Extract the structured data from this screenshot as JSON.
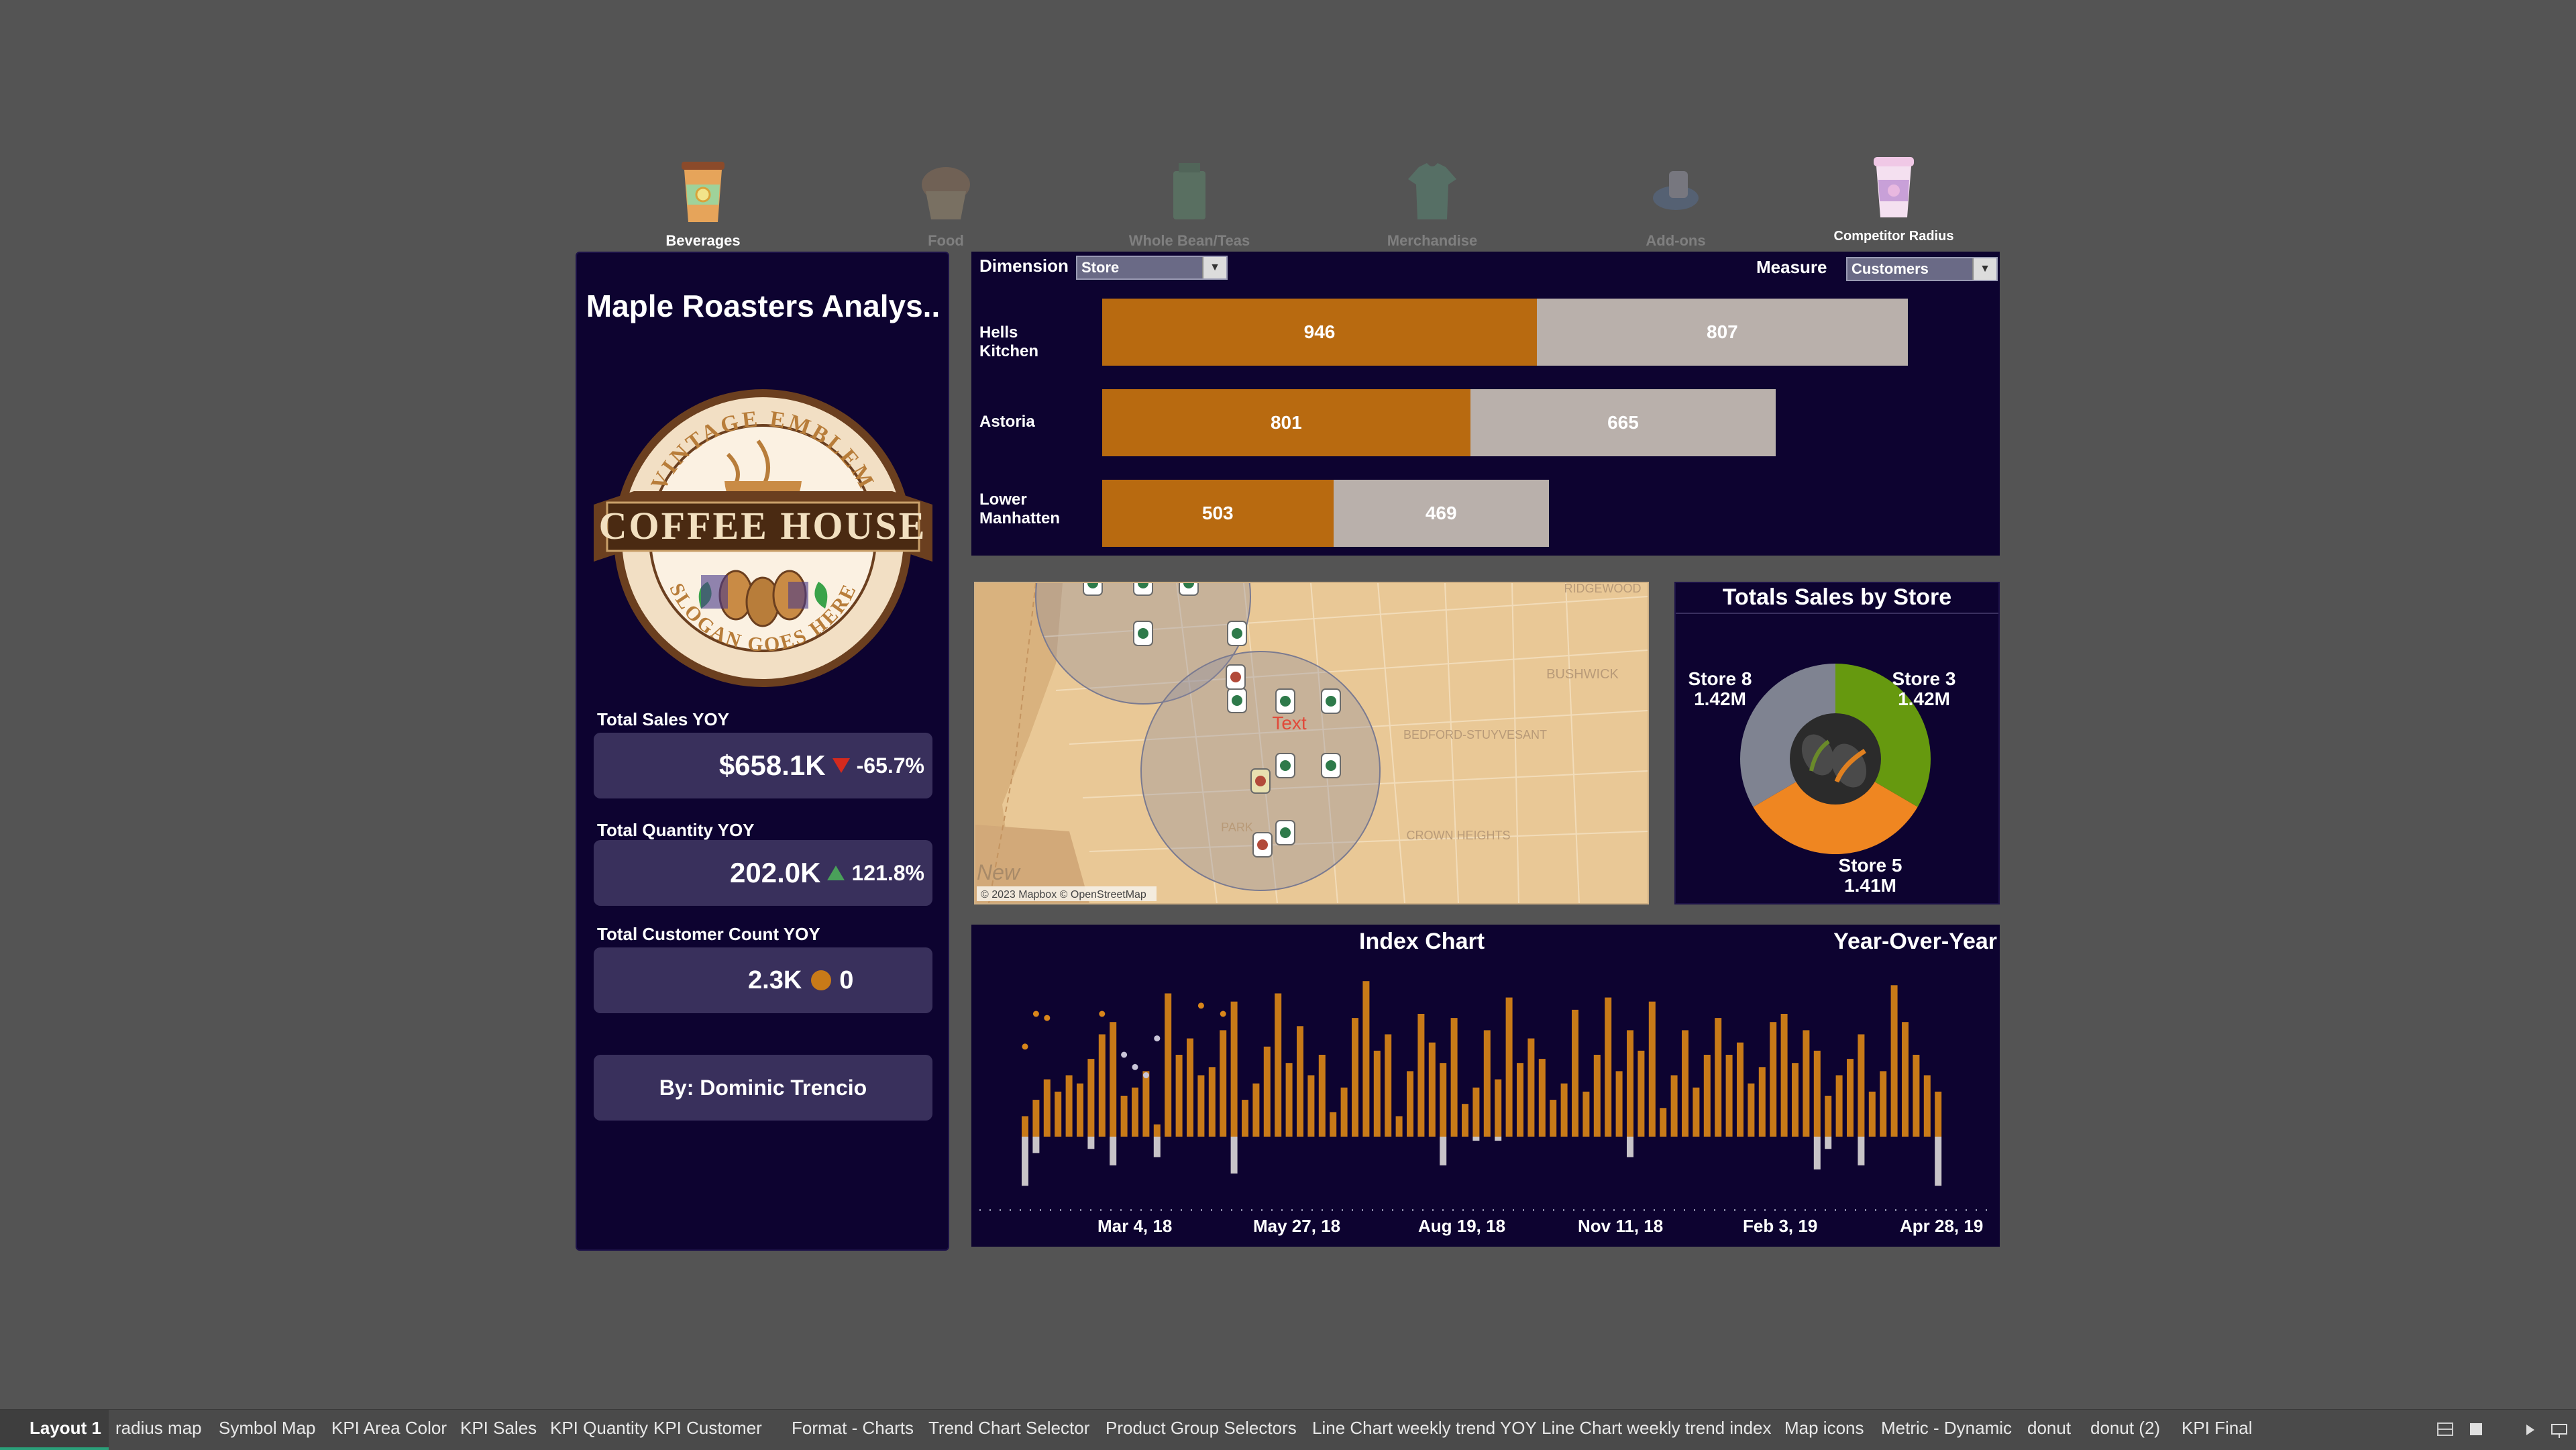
{
  "nav": [
    {
      "label": "Beverages",
      "icon": "beverage-cup-icon",
      "active": true
    },
    {
      "label": "Food",
      "icon": "muffin-icon",
      "active": false
    },
    {
      "label": "Whole Bean/Teas",
      "icon": "coffee-bag-icon",
      "active": false
    },
    {
      "label": "Merchandise",
      "icon": "tshirt-icon",
      "active": false
    },
    {
      "label": "Add-ons",
      "icon": "sauce-cup-icon",
      "active": false
    },
    {
      "label": "Competitor Radius",
      "icon": "competitor-cup-icon",
      "active": true
    }
  ],
  "left": {
    "title": "Maple Roasters Analys..",
    "logo": {
      "top": "VINTAGE EMBLEM",
      "middle": "COFFEE HOUSE",
      "bottom": "SLOGAN GOES HERE"
    },
    "kpis": [
      {
        "label": "Total Sales YOY",
        "value": "$658.1K",
        "change": "-65.7%",
        "indicator": "down"
      },
      {
        "label": "Total Quantity YOY",
        "value": "202.0K",
        "change": "121.8%",
        "indicator": "up"
      },
      {
        "label": "Total Customer Count YOY",
        "value": "2.3K",
        "change": "0",
        "indicator": "neutral"
      }
    ],
    "author": "By: Dominic Trencio"
  },
  "bars": {
    "dimension_label": "Dimension",
    "dimension_value": "Store",
    "measure_label": "Measure",
    "measure_value": "Customers",
    "rows": [
      {
        "category": "Hells Kitchen",
        "current": 946,
        "previous": 807
      },
      {
        "category": "Astoria",
        "current": 801,
        "previous": 665
      },
      {
        "category": "Lower Manhatten",
        "current": 503,
        "previous": 469
      }
    ],
    "colors": {
      "current": "#b86a10",
      "previous": "#b9b0ab"
    }
  },
  "map": {
    "attribution": "© 2023 Mapbox © OpenStreetMap",
    "areas": [
      "RIDGEWOOD",
      "BUSHWICK",
      "BEDFORD-STUYVESANT",
      "CROWN HEIGHTS",
      "PARK"
    ],
    "corner_text": "New",
    "marker_text": "Text",
    "store_marker_icon": "store-cup-icon",
    "competitor_marker_icon": "competitor-cup-icon"
  },
  "pie": {
    "title": "Totals Sales by Store",
    "center_icon": "coffee-bean-icon",
    "slices": [
      {
        "name": "Store 3",
        "label": "1.42M",
        "value": 1.42,
        "color": "#66990f"
      },
      {
        "name": "Store 5",
        "label": "1.41M",
        "value": 1.41,
        "color": "#ef8621"
      },
      {
        "name": "Store 8",
        "label": "1.42M",
        "value": 1.42,
        "color": "#7f8391"
      }
    ]
  },
  "chart_data": {
    "type": "bar",
    "title": "Index Chart",
    "subtitle": "Year-Over-Year",
    "x_tick_labels": [
      "Mar 4, 18",
      "May 27, 18",
      "Aug 19, 18",
      "Nov 11, 18",
      "Feb 3, 19",
      "Apr 28, 19"
    ],
    "series": [
      {
        "type": "bar",
        "color": "#c87a18",
        "values": [
          5,
          9,
          14,
          11,
          15,
          13,
          19,
          25,
          28,
          10,
          12,
          16,
          3,
          35,
          20,
          24,
          15,
          17,
          26,
          33,
          9,
          13,
          22,
          35,
          18,
          27,
          15,
          20,
          6,
          12,
          29,
          38,
          21,
          25,
          5,
          16,
          30,
          23,
          18,
          29,
          8,
          12,
          26,
          14,
          34,
          18,
          24,
          19,
          9,
          13,
          31,
          11,
          20,
          34,
          16,
          26,
          21,
          33,
          7,
          15,
          26,
          12,
          20,
          29,
          20,
          23,
          13,
          17,
          28,
          30,
          18,
          26,
          21,
          10,
          15,
          19,
          25,
          11,
          16,
          37,
          28,
          20,
          15,
          11
        ]
      },
      {
        "type": "bar",
        "color": "#c8c4c8",
        "values": [
          -12,
          -4,
          0,
          0,
          0,
          0,
          -3,
          0,
          -7,
          0,
          0,
          0,
          -5,
          0,
          0,
          0,
          0,
          0,
          0,
          -9,
          0,
          0,
          0,
          0,
          0,
          0,
          0,
          0,
          0,
          0,
          0,
          0,
          0,
          0,
          0,
          0,
          0,
          0,
          -7,
          0,
          0,
          -1,
          0,
          -1,
          0,
          0,
          0,
          0,
          0,
          0,
          0,
          0,
          0,
          0,
          0,
          -5,
          0,
          0,
          0,
          0,
          0,
          0,
          0,
          0,
          0,
          0,
          0,
          0,
          0,
          0,
          0,
          0,
          -8,
          -3,
          0,
          0,
          -7,
          0,
          0,
          0,
          0,
          0,
          0,
          -12
        ]
      },
      {
        "type": "dot",
        "color": "#d9861a",
        "values": [
          22,
          30,
          29,
          0,
          0,
          0,
          0,
          30,
          0,
          0,
          0,
          0,
          0,
          0,
          0,
          0,
          32,
          0,
          30,
          0,
          0,
          0,
          0,
          0,
          0,
          0,
          0,
          0,
          0,
          0,
          0,
          0,
          0,
          0,
          0,
          0,
          0,
          0,
          0,
          0,
          0,
          0,
          0,
          0,
          0,
          0,
          0,
          0,
          0,
          0,
          0,
          0,
          0,
          0,
          0,
          0,
          0,
          0,
          0,
          0,
          0,
          0,
          0,
          0,
          0,
          0,
          0,
          0,
          0,
          0,
          0,
          0,
          0,
          0,
          0,
          0,
          0,
          0,
          0,
          0,
          0,
          0,
          0,
          0
        ]
      },
      {
        "type": "dot",
        "color": "#c8c4d8",
        "values": [
          0,
          0,
          0,
          0,
          0,
          0,
          0,
          0,
          0,
          20,
          17,
          15,
          24,
          0,
          0,
          0,
          0,
          0,
          0,
          0,
          0,
          0,
          0,
          0,
          0,
          0,
          0,
          0,
          0,
          0,
          0,
          0,
          0,
          0,
          0,
          0,
          0,
          0,
          0,
          0,
          0,
          0,
          0,
          0,
          0,
          0,
          0,
          0,
          0,
          0,
          0,
          0,
          0,
          0,
          0,
          0,
          0,
          0,
          0,
          0,
          0,
          0,
          0,
          0,
          0,
          0,
          0,
          0,
          0,
          0,
          0,
          0,
          0,
          0,
          0,
          0,
          0,
          0,
          0,
          0,
          0,
          0,
          0,
          0
        ]
      }
    ]
  },
  "tabs": [
    "Layout 1",
    "radius map",
    "Symbol Map",
    "KPI Area Color",
    "KPI Sales",
    "KPI Quantity",
    "KPI Customer",
    "Format - Charts",
    "Trend Chart Selector",
    "Product Group Selectors",
    "Line Chart weekly trend YOY",
    "Line Chart weekly trend index",
    "Map icons",
    "Metric - Dynamic",
    "donut",
    "donut (2)",
    "KPI Final"
  ]
}
